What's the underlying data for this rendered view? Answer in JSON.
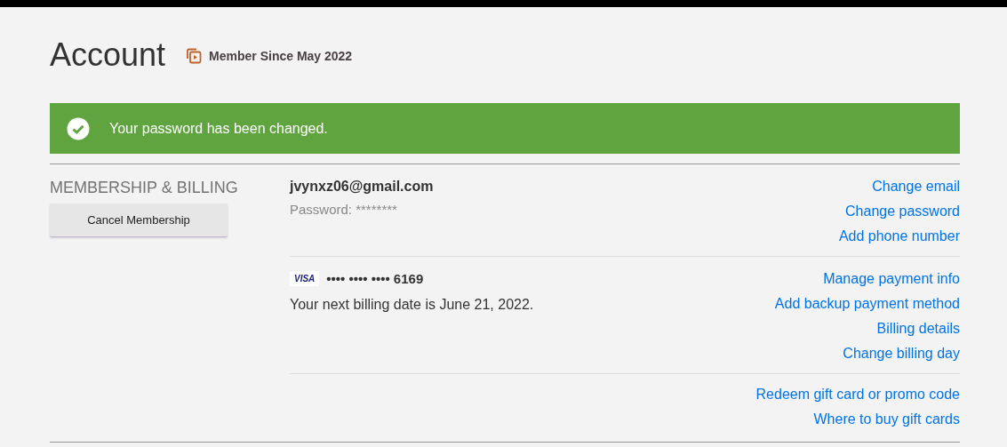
{
  "header": {
    "title": "Account",
    "member_since": "Member Since May 2022"
  },
  "alert": {
    "message": "Your password has been changed."
  },
  "section": {
    "heading": "MEMBERSHIP & BILLING",
    "button": "Cancel Membership",
    "groups": [
      {
        "kind": "account",
        "lines": [
          "jvynxz06@gmail.com",
          "Password: ********"
        ],
        "links": [
          "Change email",
          "Change password",
          "Add phone number"
        ]
      },
      {
        "kind": "payment",
        "card_brand": "VISA",
        "lines": [
          "•••• •••• •••• 6169",
          "Your next billing date is June 21, 2022."
        ],
        "links": [
          "Manage payment info",
          "Add backup payment method",
          "Billing details",
          "Change billing day"
        ]
      },
      {
        "kind": "gift",
        "links": [
          "Redeem gift card or promo code",
          "Where to buy gift cards"
        ]
      }
    ]
  }
}
